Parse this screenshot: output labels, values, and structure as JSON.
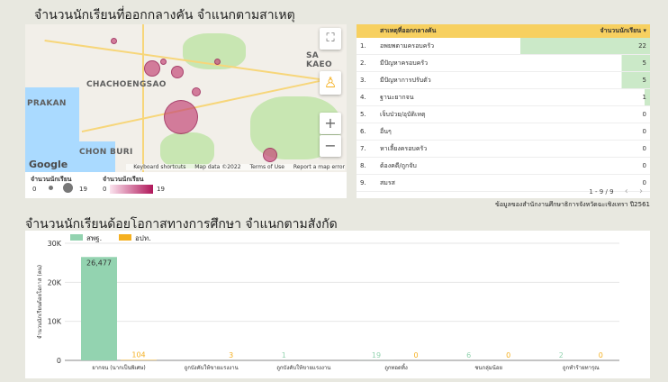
{
  "map_title": "จำนวนนักเรียนที่ออกกลางคัน จำแนกตามสาเหตุ",
  "map": {
    "place_labels": [
      "CHACHOENGSAO",
      "SA KAEO",
      "PRAKAN",
      "CHON BURI"
    ],
    "google_label": "Google",
    "footer": [
      "Keyboard shortcuts",
      "Map data ©2022",
      "Terms of Use",
      "Report a map error"
    ],
    "controls": {
      "fullscreen": "⛶",
      "zoom_in": "+",
      "zoom_out": "−"
    },
    "bubble_color": "#c44a78"
  },
  "map_legend": {
    "size_title": "จำนวนนักเรียน",
    "size_min": "0",
    "size_max": "19",
    "color_title": "จำนวนนักเรียน",
    "color_min": "0",
    "color_max": "19"
  },
  "table": {
    "col_reason": "สาเหตุที่ออกกลางคัน",
    "col_count": "จำนวนนักเรียน ▾",
    "rows": [
      {
        "no": "1.",
        "reason": "อพยพตามครอบครัว",
        "count": "22",
        "fill": 1.0
      },
      {
        "no": "2.",
        "reason": "มีปัญหาครอบครัว",
        "count": "5",
        "fill": 0.22
      },
      {
        "no": "3.",
        "reason": "มีปัญหาการปรับตัว",
        "count": "5",
        "fill": 0.22
      },
      {
        "no": "4.",
        "reason": "ฐานะยากจน",
        "count": "1",
        "fill": 0.04
      },
      {
        "no": "5.",
        "reason": "เจ็บป่วย/อุบัติเหตุ",
        "count": "0",
        "fill": 0
      },
      {
        "no": "6.",
        "reason": "อื่นๆ",
        "count": "0",
        "fill": 0
      },
      {
        "no": "7.",
        "reason": "หาเลี้ยงครอบครัว",
        "count": "0",
        "fill": 0
      },
      {
        "no": "8.",
        "reason": "ต้องคดี/ถูกจับ",
        "count": "0",
        "fill": 0
      },
      {
        "no": "9.",
        "reason": "สมรส",
        "count": "0",
        "fill": 0
      }
    ],
    "pager": "1 - 9 / 9",
    "prev": "‹",
    "next": "›"
  },
  "source_note": "ข้อมูลของสำนักงานศึกษาธิการจังหวัดฉะเชิงเทรา ปี2561",
  "chart_title": "จำนวนนักเรียนด้อยโอกาสทางการศึกษา จำแนกตามสังกัด",
  "chart_data": {
    "type": "bar",
    "ylabel": "จำนวนนักเรียนด้อยโอกาส (คน)",
    "ylim": [
      0,
      30000
    ],
    "yticks": [
      "0",
      "10K",
      "20K",
      "30K"
    ],
    "categories": [
      "ยากจน (นากเป็นพิเศษ)",
      "ถูกบังคับให้ขายแรงงาน",
      "ถูกบังคับให้ขายแรงงาน",
      "ถูกทอดทิ้ง",
      "ชนกลุ่มน้อย",
      "ถูกทำร้ายทารุณ"
    ],
    "series": [
      {
        "name": "สพฐ.",
        "color": "#93d3b0",
        "values": [
          26477,
          3,
          1,
          19,
          6,
          2
        ]
      },
      {
        "name": "อปท.",
        "color": "#f5b020",
        "values": [
          104,
          3,
          0,
          0,
          0,
          0
        ]
      }
    ],
    "data_labels": [
      [
        "26,477",
        "",
        "1",
        "19",
        "6",
        "2"
      ],
      [
        "104",
        "3",
        "",
        "0",
        "0",
        "0"
      ]
    ],
    "legend_position": "top-left",
    "grid": true
  }
}
